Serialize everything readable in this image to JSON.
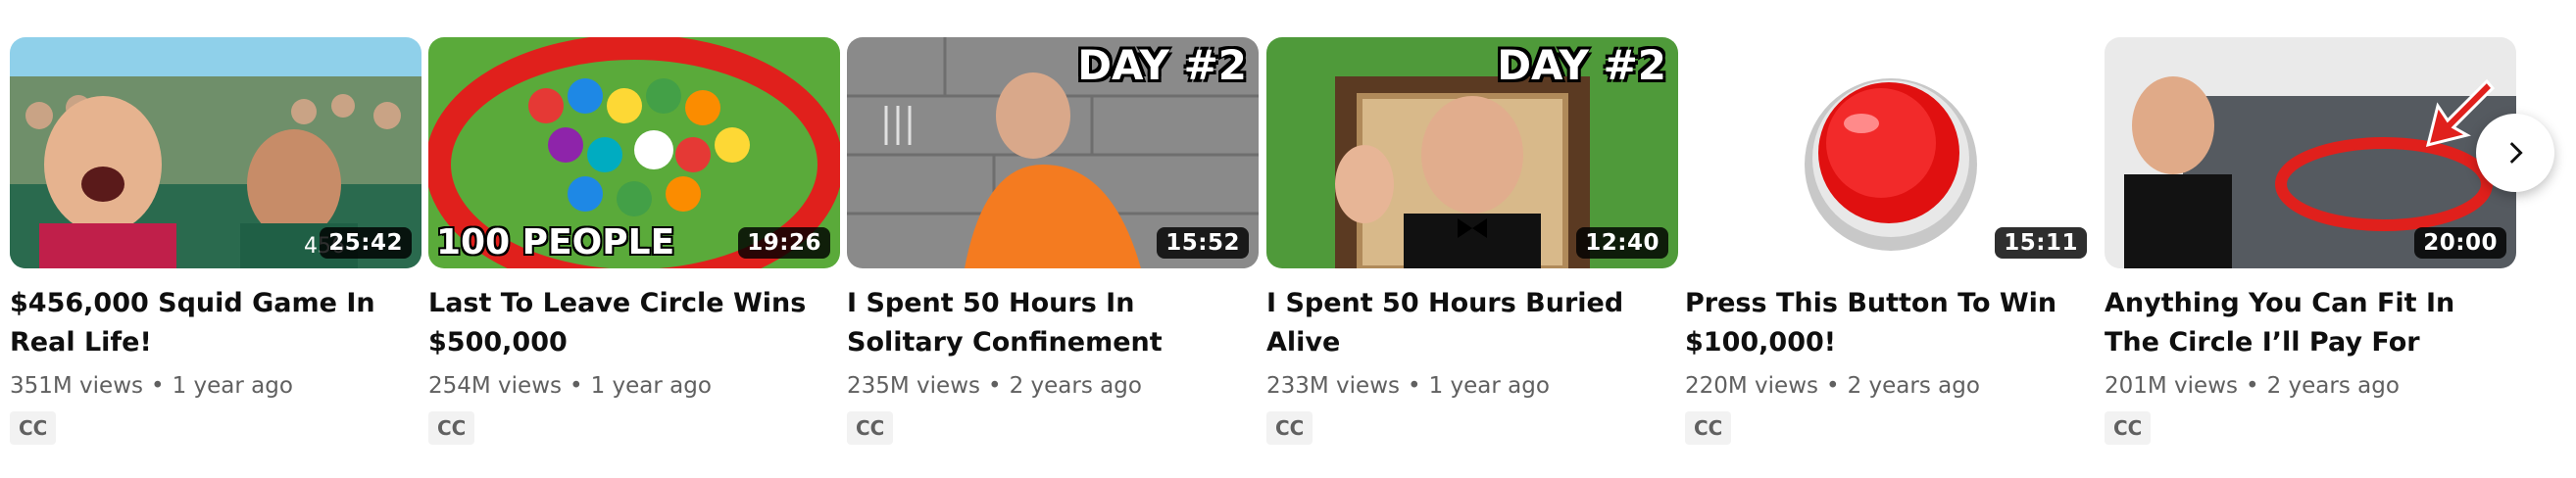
{
  "videos": [
    {
      "title": "$456,000 Squid Game In Real Life!",
      "views": "351M views",
      "age": "1 year ago",
      "duration": "25:42",
      "badge": "CC",
      "overlay_text": ""
    },
    {
      "title": "Last To Leave Circle Wins $500,000",
      "views": "254M views",
      "age": "1 year ago",
      "duration": "19:26",
      "badge": "CC",
      "overlay_text": "100 PEOPLE"
    },
    {
      "title": "I Spent 50 Hours In Solitary Confinement",
      "views": "235M views",
      "age": "2 years ago",
      "duration": "15:52",
      "badge": "CC",
      "overlay_text": "DAY #2"
    },
    {
      "title": "I Spent 50 Hours Buried Alive",
      "views": "233M views",
      "age": "1 year ago",
      "duration": "12:40",
      "badge": "CC",
      "overlay_text": "DAY #2"
    },
    {
      "title": "Press This Button To Win $100,000!",
      "views": "220M views",
      "age": "2 years ago",
      "duration": "15:11",
      "badge": "CC",
      "overlay_text": ""
    },
    {
      "title": "Anything You Can Fit In The Circle I’ll Pay For",
      "views": "201M views",
      "age": "2 years ago",
      "duration": "20:00",
      "badge": "CC",
      "overlay_text": ""
    }
  ],
  "separator": "•",
  "next_button_icon": "chevron-right-icon"
}
